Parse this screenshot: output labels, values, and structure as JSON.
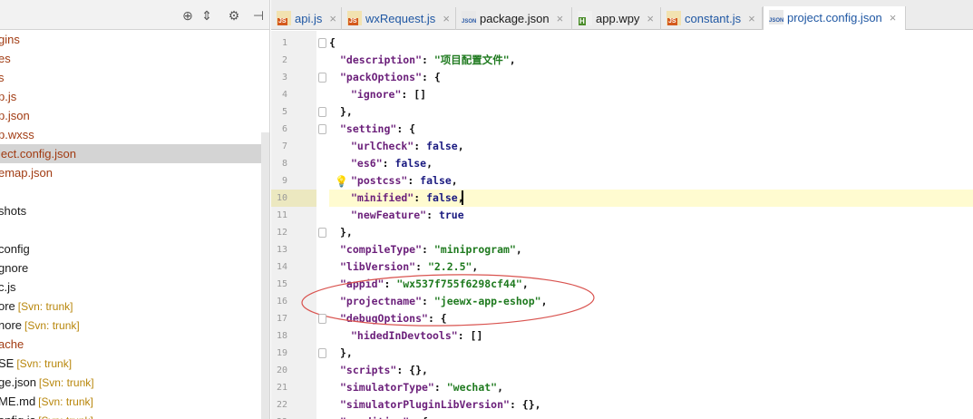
{
  "tree": {
    "title": "…",
    "toolbar_icons": [
      "target-icon",
      "collapse-icon",
      "gear-icon",
      "pin-icon"
    ],
    "items": [
      {
        "name": "gins",
        "color": "#a13b12",
        "svn": ""
      },
      {
        "name": "es",
        "color": "#a13b12",
        "svn": ""
      },
      {
        "name": "s",
        "color": "#a13b12",
        "svn": ""
      },
      {
        "name": "p.js",
        "color": "#a13b12",
        "svn": ""
      },
      {
        "name": "p.json",
        "color": "#a13b12",
        "svn": ""
      },
      {
        "name": "p.wxss",
        "color": "#a13b12",
        "svn": ""
      },
      {
        "name": "ject.config.json",
        "color": "#a13b12",
        "svn": "",
        "selected": true
      },
      {
        "name": "emap.json",
        "color": "#a13b12",
        "svn": ""
      },
      {
        "name": "",
        "color": "#1a1a1a",
        "svn": ""
      },
      {
        "name": "shots",
        "color": "#1a1a1a",
        "svn": ""
      },
      {
        "name": "",
        "color": "#1a1a1a",
        "svn": ""
      },
      {
        "name": "config",
        "color": "#1a1a1a",
        "svn": ""
      },
      {
        "name": "gnore",
        "color": "#1a1a1a",
        "svn": ""
      },
      {
        "name": "c.js",
        "color": "#1a1a1a",
        "svn": ""
      },
      {
        "name": "ore",
        "color": "#1a1a1a",
        "svn": "[Svn: trunk]"
      },
      {
        "name": "nore",
        "color": "#1a1a1a",
        "svn": "[Svn: trunk]"
      },
      {
        "name": "ache",
        "color": "#a13b12",
        "svn": ""
      },
      {
        "name": "SE",
        "color": "#1a1a1a",
        "svn": "[Svn: trunk]"
      },
      {
        "name": "ge.json",
        "color": "#1a1a1a",
        "svn": "[Svn: trunk]"
      },
      {
        "name": "ME.md",
        "color": "#1a1a1a",
        "svn": "[Svn: trunk]"
      },
      {
        "name": "onfig.js",
        "color": "#1a1a1a",
        "svn": "[Svn: trunk]"
      }
    ]
  },
  "tabs": [
    {
      "label": "api.js",
      "icon": "js",
      "active": false
    },
    {
      "label": "wxRequest.js",
      "icon": "js",
      "active": false
    },
    {
      "label": "package.json",
      "icon": "json",
      "active": false
    },
    {
      "label": "app.wpy",
      "icon": "wpy",
      "active": false
    },
    {
      "label": "constant.js",
      "icon": "js",
      "active": false
    },
    {
      "label": "project.config.json",
      "icon": "json",
      "active": true
    }
  ],
  "editor": {
    "highlight_line": 10,
    "lines": [
      {
        "n": "1",
        "indent": 0,
        "tokens": [
          [
            "p",
            "{"
          ]
        ]
      },
      {
        "n": "2",
        "indent": 1,
        "tokens": [
          [
            "k",
            "\"description\""
          ],
          [
            "p",
            ": "
          ],
          [
            "s",
            "\"项目配置文件\""
          ],
          [
            "p",
            ","
          ]
        ]
      },
      {
        "n": "3",
        "indent": 1,
        "tokens": [
          [
            "k",
            "\"packOptions\""
          ],
          [
            "p",
            ": {"
          ]
        ]
      },
      {
        "n": "4",
        "indent": 2,
        "tokens": [
          [
            "k",
            "\"ignore\""
          ],
          [
            "p",
            ": []"
          ]
        ]
      },
      {
        "n": "5",
        "indent": 1,
        "tokens": [
          [
            "p",
            "},"
          ]
        ]
      },
      {
        "n": "6",
        "indent": 1,
        "tokens": [
          [
            "k",
            "\"setting\""
          ],
          [
            "p",
            ": {"
          ]
        ]
      },
      {
        "n": "7",
        "indent": 2,
        "tokens": [
          [
            "k",
            "\"urlCheck\""
          ],
          [
            "p",
            ": "
          ],
          [
            "b",
            "false"
          ],
          [
            "p",
            ","
          ]
        ]
      },
      {
        "n": "8",
        "indent": 2,
        "tokens": [
          [
            "k",
            "\"es6\""
          ],
          [
            "p",
            ": "
          ],
          [
            "b",
            "false"
          ],
          [
            "p",
            ","
          ]
        ]
      },
      {
        "n": "9",
        "indent": 2,
        "tokens": [
          [
            "k",
            "\"postcss\""
          ],
          [
            "p",
            ": "
          ],
          [
            "b",
            "false"
          ],
          [
            "p",
            ","
          ]
        ]
      },
      {
        "n": "10",
        "indent": 2,
        "tokens": [
          [
            "k",
            "\"minified\""
          ],
          [
            "p",
            ": "
          ],
          [
            "b",
            "false"
          ],
          [
            "p",
            ","
          ]
        ]
      },
      {
        "n": "11",
        "indent": 2,
        "tokens": [
          [
            "k",
            "\"newFeature\""
          ],
          [
            "p",
            ": "
          ],
          [
            "b",
            "true"
          ]
        ]
      },
      {
        "n": "12",
        "indent": 1,
        "tokens": [
          [
            "p",
            "},"
          ]
        ]
      },
      {
        "n": "13",
        "indent": 1,
        "tokens": [
          [
            "k",
            "\"compileType\""
          ],
          [
            "p",
            ": "
          ],
          [
            "s",
            "\"miniprogram\""
          ],
          [
            "p",
            ","
          ]
        ]
      },
      {
        "n": "14",
        "indent": 1,
        "tokens": [
          [
            "k",
            "\"libVersion\""
          ],
          [
            "p",
            ": "
          ],
          [
            "s",
            "\"2.2.5\""
          ],
          [
            "p",
            ","
          ]
        ]
      },
      {
        "n": "15",
        "indent": 1,
        "tokens": [
          [
            "k",
            "\"appid\""
          ],
          [
            "p",
            ": "
          ],
          [
            "s",
            "\"wx537f755f6298cf44\""
          ],
          [
            "p",
            ","
          ]
        ]
      },
      {
        "n": "16",
        "indent": 1,
        "tokens": [
          [
            "k",
            "\"projectname\""
          ],
          [
            "p",
            ": "
          ],
          [
            "s",
            "\"jeewx-app-eshop\""
          ],
          [
            "p",
            ","
          ]
        ]
      },
      {
        "n": "17",
        "indent": 1,
        "tokens": [
          [
            "k",
            "\"debugOptions\""
          ],
          [
            "p",
            ": {"
          ]
        ]
      },
      {
        "n": "18",
        "indent": 2,
        "tokens": [
          [
            "k",
            "\"hidedInDevtools\""
          ],
          [
            "p",
            ": []"
          ]
        ]
      },
      {
        "n": "19",
        "indent": 1,
        "tokens": [
          [
            "p",
            "},"
          ]
        ]
      },
      {
        "n": "20",
        "indent": 1,
        "tokens": [
          [
            "k",
            "\"scripts\""
          ],
          [
            "p",
            ": {},"
          ]
        ]
      },
      {
        "n": "21",
        "indent": 1,
        "tokens": [
          [
            "k",
            "\"simulatorType\""
          ],
          [
            "p",
            ": "
          ],
          [
            "s",
            "\"wechat\""
          ],
          [
            "p",
            ","
          ]
        ]
      },
      {
        "n": "22",
        "indent": 1,
        "tokens": [
          [
            "k",
            "\"simulatorPluginLibVersion\""
          ],
          [
            "p",
            ": {},"
          ]
        ]
      },
      {
        "n": "23",
        "indent": 1,
        "tokens": [
          [
            "k",
            "\"condition\""
          ],
          [
            "p",
            ": {"
          ]
        ]
      }
    ]
  },
  "colors": {
    "keyword": "#6b1f7a",
    "string": "#1f7a1f",
    "boolean": "#1a1a80",
    "annotation": "#d9534f",
    "selected_row": "#d4d4d4"
  }
}
